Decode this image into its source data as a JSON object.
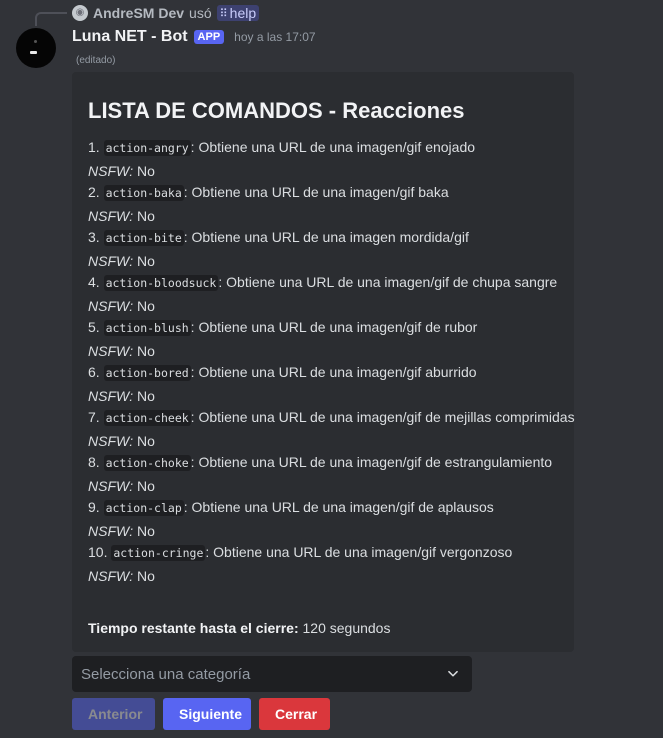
{
  "reply": {
    "user": "AndreSM Dev",
    "action": "usó",
    "command": "help"
  },
  "message": {
    "author": "Luna NET  - Bot",
    "badge": "APP",
    "timestamp": "hoy a las 17:07",
    "edited": "(editado)"
  },
  "embed": {
    "title": "LISTA DE COMANDOS - Reacciones",
    "nsfw_label": "NSFW:",
    "commands": [
      {
        "num": "1.",
        "name": "action-angry",
        "desc": ": Obtiene una URL de una imagen/gif enojado",
        "nsfw": "No"
      },
      {
        "num": "2.",
        "name": "action-baka",
        "desc": ": Obtiene una URL de una imagen/gif baka",
        "nsfw": "No"
      },
      {
        "num": "3.",
        "name": "action-bite",
        "desc": ": Obtiene una URL de una imagen mordida/gif",
        "nsfw": "No"
      },
      {
        "num": "4.",
        "name": "action-bloodsuck",
        "desc": ": Obtiene una URL de una imagen/gif de chupa sangre",
        "nsfw": "No"
      },
      {
        "num": "5.",
        "name": "action-blush",
        "desc": ": Obtiene una URL de una imagen/gif de rubor",
        "nsfw": "No"
      },
      {
        "num": "6.",
        "name": "action-bored",
        "desc": ": Obtiene una URL de una imagen/gif aburrido",
        "nsfw": "No"
      },
      {
        "num": "7.",
        "name": "action-cheek",
        "desc": ": Obtiene una URL de una imagen/gif de mejillas comprimidas",
        "nsfw": "No"
      },
      {
        "num": "8.",
        "name": "action-choke",
        "desc": ": Obtiene una URL de una imagen/gif de estrangulamiento",
        "nsfw": "No"
      },
      {
        "num": "9.",
        "name": "action-clap",
        "desc": ": Obtiene una URL de una imagen/gif de aplausos",
        "nsfw": "No"
      },
      {
        "num": "10.",
        "name": "action-cringe",
        "desc": ": Obtiene una URL de una imagen/gif vergonzoso",
        "nsfw": "No"
      }
    ],
    "footer_label": "Tiempo restante hasta el cierre:",
    "footer_value": "120 segundos"
  },
  "select": {
    "placeholder": "Selecciona una categoría"
  },
  "buttons": {
    "prev": "Anterior",
    "next": "Siguiente",
    "close": "Cerrar"
  },
  "colors": {
    "background": "#313338",
    "embed": "#2b2d31",
    "blurple": "#5865f2",
    "danger": "#da373c"
  },
  "icons": {
    "reply_avatar": "default-avatar-icon",
    "slash": "slash-command-icon",
    "chevron": "chevron-down-icon"
  }
}
